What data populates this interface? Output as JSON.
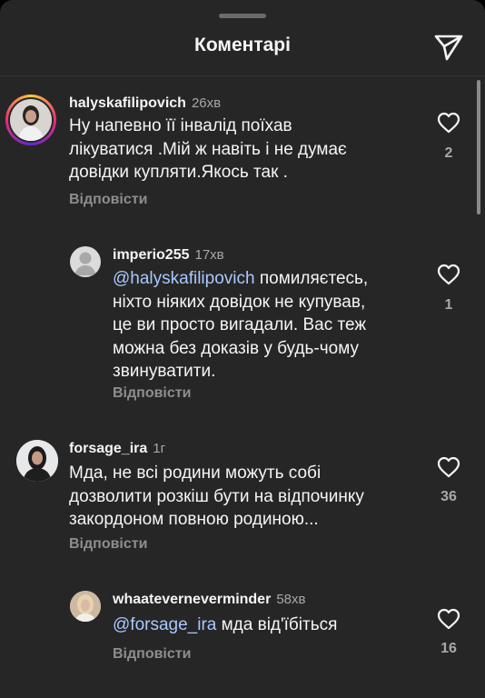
{
  "header": {
    "title": "Коментарі"
  },
  "comments": [
    {
      "username": "halyskafilipovich",
      "time": "26хв",
      "lines": [
        "Ну напевно її інвалід поїхав",
        "лікуватися .Мій ж навіть і не думає",
        "довідки купляти.Якось так ."
      ],
      "reply_label": "Відповісти",
      "likes": "2"
    },
    {
      "username": "imperio255",
      "time": "17хв",
      "mention": "@halyskafilipovich",
      "first_line_rest": " помиляєтесь,",
      "lines": [
        "ніхто ніяких довідок не купував,",
        "це ви просто вигадали. Вас теж",
        "можна без доказів у будь-чому",
        "звинуватити."
      ],
      "reply_label": "Відповісти",
      "likes": "1"
    },
    {
      "username": "forsage_ira",
      "time": "1г",
      "lines": [
        "Мда, не всі родини можуть собі",
        "дозволити розкіш бути на відпочинку",
        "закордоном повною родиною..."
      ],
      "reply_label": "Відповісти",
      "likes": "36"
    },
    {
      "username": "whaateverneverminder",
      "time": "58хв",
      "mention": "@forsage_ira",
      "first_line_rest": " мда від'їбіться",
      "reply_label": "Відповісти",
      "likes": "16"
    }
  ],
  "icons": {
    "send": "send-icon",
    "like": "heart-outline-icon"
  },
  "colors": {
    "background": "#262626",
    "mention": "#a9c8ff",
    "secondary_text": "#8e8e8e"
  }
}
